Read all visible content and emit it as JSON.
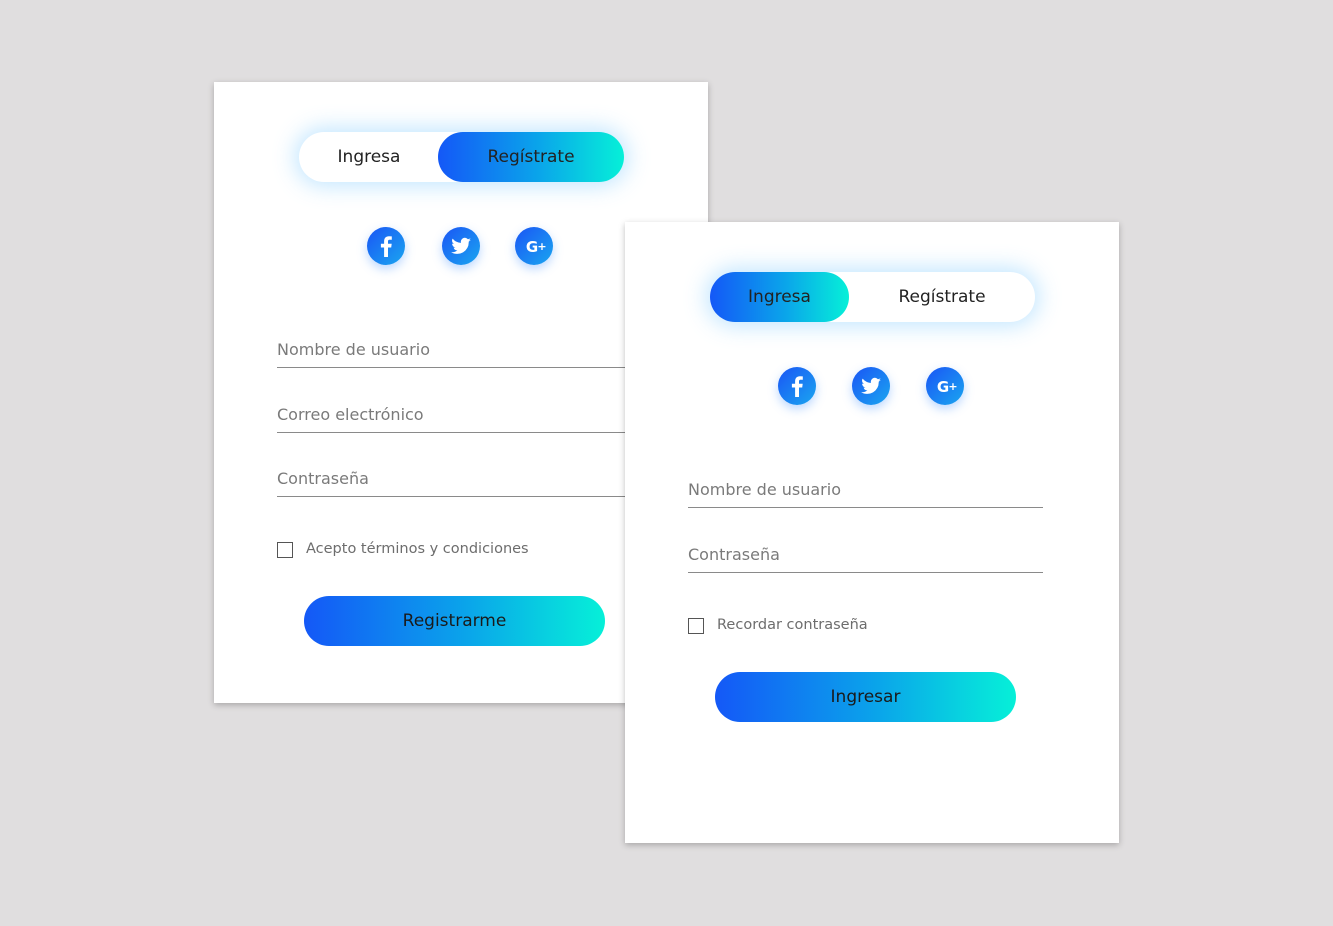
{
  "register_card": {
    "toggle": {
      "login_label": "Ingresa",
      "register_label": "Regístrate",
      "active": "register"
    },
    "socials": [
      "facebook-icon",
      "twitter-icon",
      "google-plus-icon"
    ],
    "fields": {
      "username_placeholder": "Nombre de usuario",
      "email_placeholder": "Correo electrónico",
      "password_placeholder": "Contraseña"
    },
    "terms_label": "Acepto términos y condiciones",
    "submit_label": "Registrarme"
  },
  "login_card": {
    "toggle": {
      "login_label": "Ingresa",
      "register_label": "Regístrate",
      "active": "login"
    },
    "socials": [
      "facebook-icon",
      "twitter-icon",
      "google-plus-icon"
    ],
    "fields": {
      "username_placeholder": "Nombre de usuario",
      "password_placeholder": "Contraseña"
    },
    "remember_label": "Recordar contraseña",
    "submit_label": "Ingresar"
  },
  "colors": {
    "background": "#e0dedf",
    "gradient_start": "#1458f7",
    "gradient_end": "#06f0d8",
    "social_icon": "#1a73f5"
  }
}
